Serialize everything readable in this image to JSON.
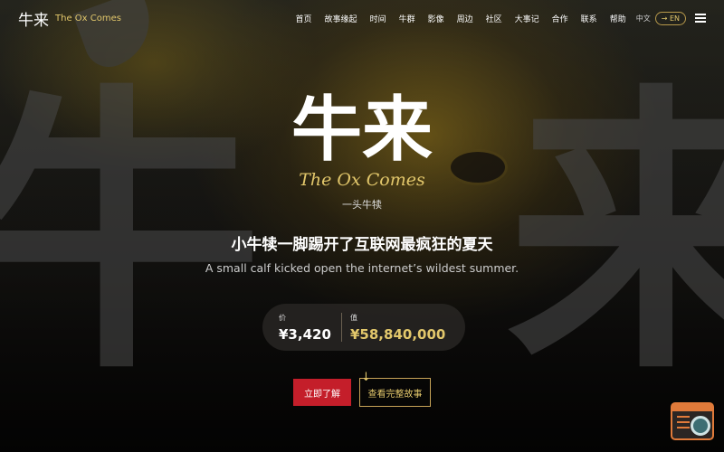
{
  "nav": {
    "logo_cjk": "牛来",
    "logo_en": "The Ox Comes",
    "items": [
      "首页",
      "故事缘起",
      "时间",
      "牛群",
      "影像",
      "周边",
      "社区",
      "大事记",
      "合作",
      "联系",
      "帮助"
    ],
    "lang_current": "中文",
    "lang_switch": "→ EN",
    "menu_icon": "hamburger-icon"
  },
  "background": {
    "left_char": "牛",
    "right_char": "来"
  },
  "hero": {
    "title_cjk": "牛来",
    "title_en": "The Ox Comes",
    "subtitle": "一头牛犊",
    "tagline_cn": "小牛犊一脚踢开了互联网最疯狂的夏天",
    "tagline_en": "A small calf kicked open the internet’s wildest summer."
  },
  "stats": {
    "a_label": "价",
    "a_value": "¥3,420",
    "b_label": "值",
    "b_value": "¥58,840,000"
  },
  "buttons": {
    "primary": "立即了解",
    "secondary": "查看完整故事"
  },
  "widget": {
    "icon": "code-search-icon"
  },
  "colors": {
    "accent_gold": "#e2c76b",
    "primary_red": "#c41e2a",
    "widget_orange": "#e07a3a"
  }
}
